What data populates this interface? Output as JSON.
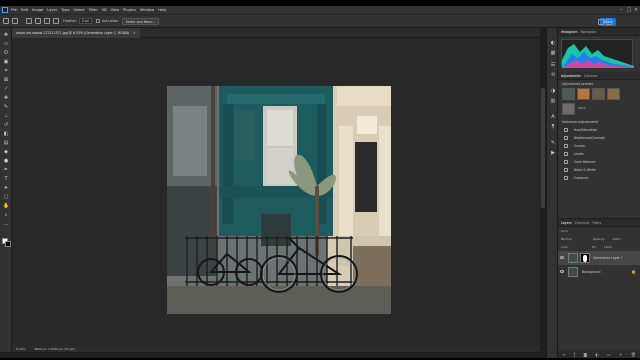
{
  "menu": [
    "File",
    "Edit",
    "Image",
    "Layer",
    "Type",
    "Select",
    "Filter",
    "3D",
    "View",
    "Plugins",
    "Window",
    "Help"
  ],
  "options_bar": {
    "feather_label": "Feather:",
    "feather_value": "0 px",
    "anti_alias_label": "Anti-alias",
    "select_mask_button": "Select and Mask...",
    "share_label": "Share"
  },
  "document": {
    "tab_title": "jessie-lee-woods-172311571.jpg @ 6.33% (Generative Layer 1, RGB/8)",
    "zoom": "6.33%",
    "status_text": "8000 px x 6000 px (72 ppi)"
  },
  "histogram_panel": {
    "tabs": [
      "Histogram",
      "Navigator"
    ]
  },
  "adjustments_panel": {
    "tabs": [
      "Adjustments",
      "Libraries"
    ],
    "presets_header": "Adjustment presets",
    "more_label": "More",
    "individual_header": "Individual adjustments",
    "items": [
      "Hue/Saturation",
      "Brightness/Contrast",
      "Curves",
      "Levels",
      "Color Balance",
      "Black & White",
      "Exposure"
    ]
  },
  "layers_panel": {
    "tabs": [
      "Layers",
      "Channels",
      "Paths"
    ],
    "filter_label": "Kind",
    "blend_mode": "Normal",
    "opacity_label": "Opacity:",
    "opacity_value": "100%",
    "lock_label": "Lock:",
    "fill_label": "Fill:",
    "fill_value": "100%",
    "layers": [
      {
        "name": "Generative Layer 1"
      },
      {
        "name": "Background"
      }
    ]
  },
  "colors": {
    "accent": "#1473e6",
    "teal_house": "#1e5b5f"
  }
}
